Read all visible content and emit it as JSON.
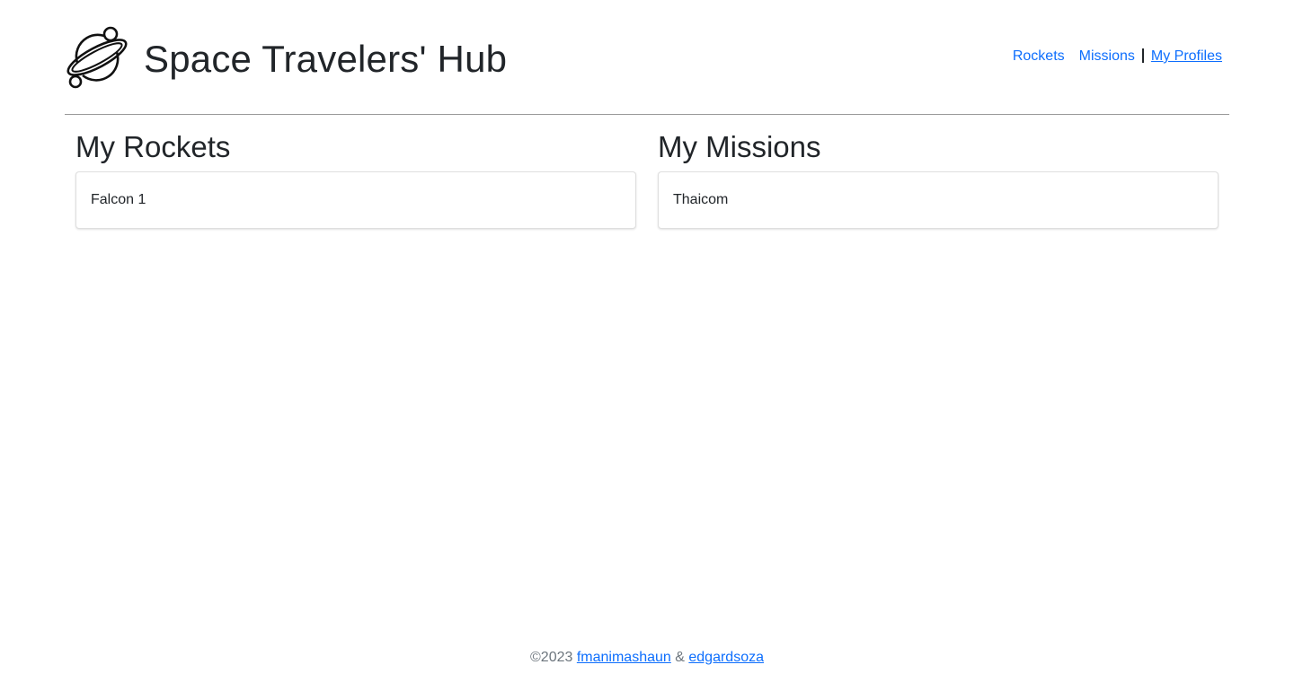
{
  "app": {
    "title": "Space Travelers' Hub",
    "logo_icon": "planet-icon"
  },
  "nav": {
    "items": [
      {
        "label": "Rockets",
        "active": false
      },
      {
        "label": "Missions",
        "active": false
      },
      {
        "label": "My Profiles",
        "active": true
      }
    ],
    "separator": "|"
  },
  "profile": {
    "rockets": {
      "heading": "My Rockets",
      "items": [
        "Falcon 1"
      ]
    },
    "missions": {
      "heading": "My Missions",
      "items": [
        "Thaicom"
      ]
    }
  },
  "footer": {
    "copyright": "©2023",
    "author1": "fmanimashaun",
    "ampersand": "&",
    "author2": "edgardsoza"
  },
  "colors": {
    "link": "#0d6efd",
    "text": "#212529",
    "divider": "#9a9a9a"
  }
}
